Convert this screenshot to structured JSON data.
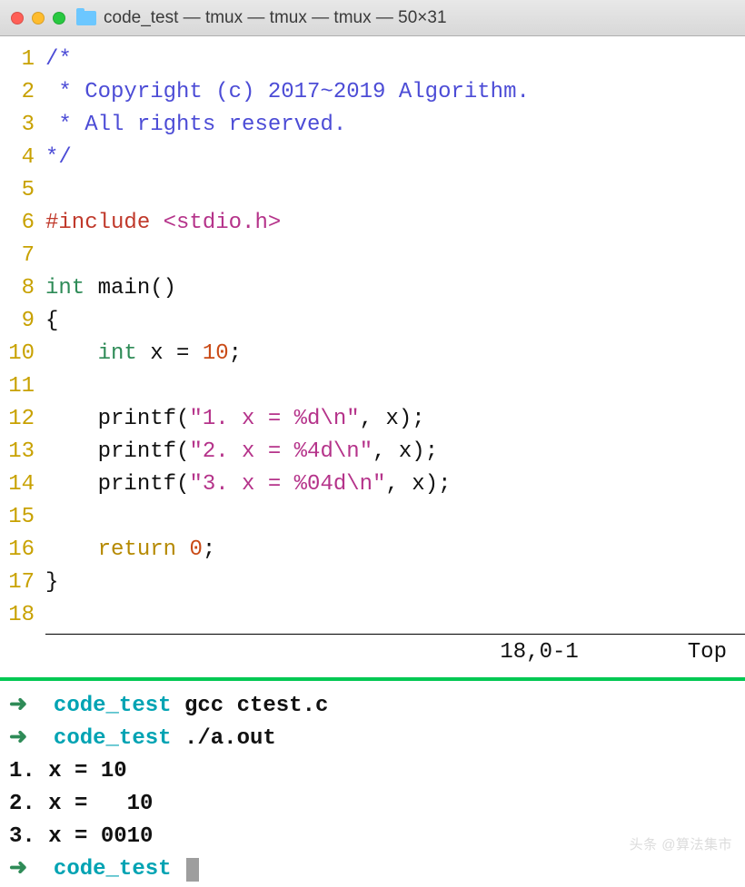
{
  "titlebar": {
    "title": "code_test — tmux — tmux — tmux — 50×31"
  },
  "editor": {
    "lines": [
      {
        "n": "1",
        "tokens": [
          {
            "t": "/*",
            "c": "c-comment"
          }
        ]
      },
      {
        "n": "2",
        "tokens": [
          {
            "t": " * Copyright (c) 2017~2019 Algorithm.",
            "c": "c-comment"
          }
        ]
      },
      {
        "n": "3",
        "tokens": [
          {
            "t": " * All rights reserved.",
            "c": "c-comment"
          }
        ]
      },
      {
        "n": "4",
        "tokens": [
          {
            "t": "*/",
            "c": "c-comment"
          }
        ]
      },
      {
        "n": "5",
        "tokens": []
      },
      {
        "n": "6",
        "tokens": [
          {
            "t": "#include ",
            "c": "c-pre"
          },
          {
            "t": "<stdio.h>",
            "c": "c-header"
          }
        ]
      },
      {
        "n": "7",
        "tokens": []
      },
      {
        "n": "8",
        "tokens": [
          {
            "t": "int",
            "c": "c-type"
          },
          {
            "t": " ",
            "c": ""
          },
          {
            "t": "main",
            "c": "c-ident"
          },
          {
            "t": "()",
            "c": "c-punct"
          }
        ]
      },
      {
        "n": "9",
        "tokens": [
          {
            "t": "{",
            "c": "c-brace"
          }
        ]
      },
      {
        "n": "10",
        "tokens": [
          {
            "t": "    ",
            "c": ""
          },
          {
            "t": "int",
            "c": "c-type"
          },
          {
            "t": " x = ",
            "c": "c-ident"
          },
          {
            "t": "10",
            "c": "c-num"
          },
          {
            "t": ";",
            "c": "c-punct"
          }
        ]
      },
      {
        "n": "11",
        "tokens": []
      },
      {
        "n": "12",
        "tokens": [
          {
            "t": "    ",
            "c": ""
          },
          {
            "t": "printf",
            "c": "c-func"
          },
          {
            "t": "(",
            "c": "c-punct"
          },
          {
            "t": "\"1. x = ",
            "c": "c-str"
          },
          {
            "t": "%d",
            "c": "c-fmt"
          },
          {
            "t": "\\n",
            "c": "c-esc"
          },
          {
            "t": "\"",
            "c": "c-str"
          },
          {
            "t": ", x);",
            "c": "c-punct"
          }
        ]
      },
      {
        "n": "13",
        "tokens": [
          {
            "t": "    ",
            "c": ""
          },
          {
            "t": "printf",
            "c": "c-func"
          },
          {
            "t": "(",
            "c": "c-punct"
          },
          {
            "t": "\"2. x = ",
            "c": "c-str"
          },
          {
            "t": "%4d",
            "c": "c-fmt"
          },
          {
            "t": "\\n",
            "c": "c-esc"
          },
          {
            "t": "\"",
            "c": "c-str"
          },
          {
            "t": ", x);",
            "c": "c-punct"
          }
        ]
      },
      {
        "n": "14",
        "tokens": [
          {
            "t": "    ",
            "c": ""
          },
          {
            "t": "printf",
            "c": "c-func"
          },
          {
            "t": "(",
            "c": "c-punct"
          },
          {
            "t": "\"3. x = ",
            "c": "c-str"
          },
          {
            "t": "%04d",
            "c": "c-fmt"
          },
          {
            "t": "\\n",
            "c": "c-esc"
          },
          {
            "t": "\"",
            "c": "c-str"
          },
          {
            "t": ", x);",
            "c": "c-punct"
          }
        ]
      },
      {
        "n": "15",
        "tokens": []
      },
      {
        "n": "16",
        "tokens": [
          {
            "t": "    ",
            "c": ""
          },
          {
            "t": "return",
            "c": "c-kw"
          },
          {
            "t": " ",
            "c": ""
          },
          {
            "t": "0",
            "c": "c-num"
          },
          {
            "t": ";",
            "c": "c-punct"
          }
        ]
      },
      {
        "n": "17",
        "tokens": [
          {
            "t": "}",
            "c": "c-brace"
          }
        ]
      },
      {
        "n": "18",
        "tokens": []
      }
    ],
    "status": {
      "position": "18,0-1",
      "view": "Top"
    }
  },
  "terminal": {
    "lines": [
      {
        "type": "prompt",
        "arrow": "➜",
        "dir": "code_test",
        "cmd": "gcc ctest.c"
      },
      {
        "type": "prompt",
        "arrow": "➜",
        "dir": "code_test",
        "cmd": "./a.out"
      },
      {
        "type": "output",
        "text": "1. x = 10"
      },
      {
        "type": "output",
        "text": "2. x =   10"
      },
      {
        "type": "output",
        "text": "3. x = 0010"
      },
      {
        "type": "prompt",
        "arrow": "➜",
        "dir": "code_test",
        "cmd": "",
        "cursor": true
      }
    ]
  },
  "watermark": "头条 @算法集市"
}
